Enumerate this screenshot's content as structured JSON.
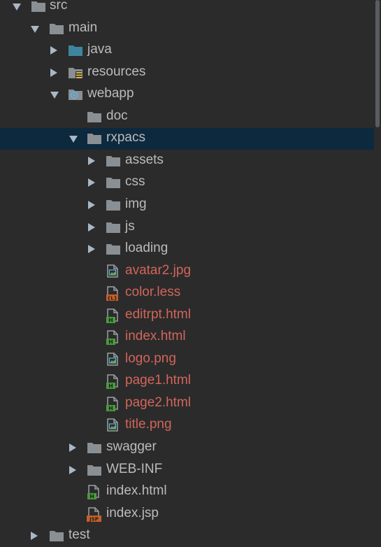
{
  "tree": [
    {
      "label": "src",
      "icon": "folder-icon",
      "state": "expanded",
      "modified": false,
      "selected": false
    },
    {
      "label": "main",
      "icon": "folder-icon",
      "state": "expanded",
      "modified": false,
      "selected": false
    },
    {
      "label": "java",
      "icon": "source-folder-icon",
      "state": "collapsed",
      "modified": false,
      "selected": false
    },
    {
      "label": "resources",
      "icon": "resources-folder-icon",
      "state": "collapsed",
      "modified": false,
      "selected": false
    },
    {
      "label": "webapp",
      "icon": "web-folder-icon",
      "state": "expanded",
      "modified": false,
      "selected": false
    },
    {
      "label": "doc",
      "icon": "folder-icon",
      "state": "none",
      "modified": false,
      "selected": false
    },
    {
      "label": "rxpacs",
      "icon": "folder-icon",
      "state": "expanded",
      "modified": false,
      "selected": true
    },
    {
      "label": "assets",
      "icon": "folder-icon",
      "state": "collapsed",
      "modified": false,
      "selected": false
    },
    {
      "label": "css",
      "icon": "folder-icon",
      "state": "collapsed",
      "modified": false,
      "selected": false
    },
    {
      "label": "img",
      "icon": "folder-icon",
      "state": "collapsed",
      "modified": false,
      "selected": false
    },
    {
      "label": "js",
      "icon": "folder-icon",
      "state": "collapsed",
      "modified": false,
      "selected": false
    },
    {
      "label": "loading",
      "icon": "folder-icon",
      "state": "collapsed",
      "modified": false,
      "selected": false
    },
    {
      "label": "avatar2.jpg",
      "icon": "image-file-icon",
      "state": "none",
      "modified": true,
      "selected": false
    },
    {
      "label": "color.less",
      "icon": "less-file-icon",
      "state": "none",
      "modified": true,
      "selected": false
    },
    {
      "label": "editrpt.html",
      "icon": "html-file-icon",
      "state": "none",
      "modified": true,
      "selected": false
    },
    {
      "label": "index.html",
      "icon": "html-file-icon",
      "state": "none",
      "modified": true,
      "selected": false
    },
    {
      "label": "logo.png",
      "icon": "image-file-icon",
      "state": "none",
      "modified": true,
      "selected": false
    },
    {
      "label": "page1.html",
      "icon": "html-file-icon",
      "state": "none",
      "modified": true,
      "selected": false
    },
    {
      "label": "page2.html",
      "icon": "html-file-icon",
      "state": "none",
      "modified": true,
      "selected": false
    },
    {
      "label": "title.png",
      "icon": "image-file-icon",
      "state": "none",
      "modified": true,
      "selected": false
    },
    {
      "label": "swagger",
      "icon": "folder-icon",
      "state": "collapsed",
      "modified": false,
      "selected": false
    },
    {
      "label": "WEB-INF",
      "icon": "folder-icon",
      "state": "collapsed",
      "modified": false,
      "selected": false
    },
    {
      "label": "index.html",
      "icon": "html-file-icon",
      "state": "none",
      "modified": false,
      "selected": false
    },
    {
      "label": "index.jsp",
      "icon": "jsp-file-icon",
      "state": "none",
      "modified": false,
      "selected": false
    },
    {
      "label": "test",
      "icon": "folder-icon",
      "state": "collapsed",
      "modified": false,
      "selected": false
    }
  ],
  "colors": {
    "background": "#2b2b2b",
    "selection": "#0d293e",
    "text": "#bbbbbb",
    "modified_text": "#d2655a",
    "folder": "#8a8f94",
    "source_folder": "#3e86a0",
    "html_badge": "#4a9c3c",
    "less_badge": "#c65f2a",
    "jsp_badge": "#c65f2a"
  }
}
